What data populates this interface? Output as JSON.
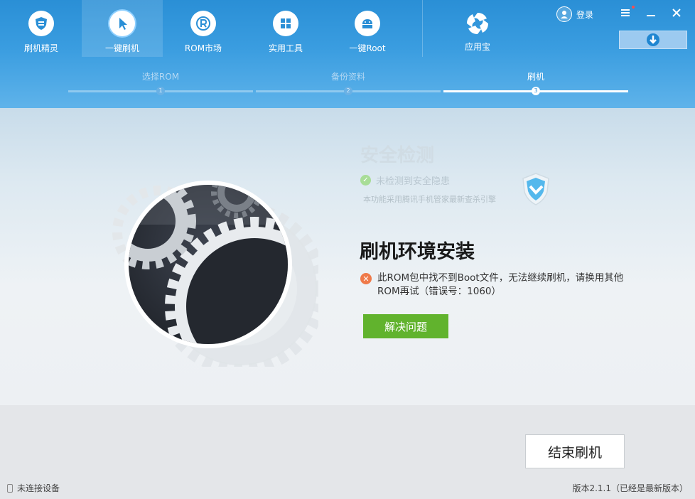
{
  "nav": {
    "items": [
      {
        "label": "刷机精灵",
        "icon": "shield-logo-icon"
      },
      {
        "label": "一键刷机",
        "icon": "cursor-icon"
      },
      {
        "label": "ROM市场",
        "icon": "rom-icon"
      },
      {
        "label": "实用工具",
        "icon": "grid-icon"
      },
      {
        "label": "一键Root",
        "icon": "android-icon"
      },
      {
        "label": "应用宝",
        "icon": "app-store-icon"
      }
    ],
    "active_index": 1
  },
  "header": {
    "login_label": "登录",
    "controls": [
      "menu-icon",
      "minimize-icon",
      "close-icon"
    ]
  },
  "steps": [
    {
      "label": "选择ROM",
      "num": "1"
    },
    {
      "label": "备份资料",
      "num": "2"
    },
    {
      "label": "刷机",
      "num": "3"
    }
  ],
  "current_step": 3,
  "security": {
    "title": "安全检测",
    "status": "未检测到安全隐患",
    "note": "本功能采用腾讯手机管家最新查杀引擎"
  },
  "main": {
    "title": "刷机环境安装",
    "error_text": "此ROM包中找不到Boot文件，无法继续刷机，请换用其他ROM再试（错误号：1060）",
    "fix_button": "解决问题"
  },
  "bottom": {
    "end_button": "结束刷机",
    "device_status": "未连接设备",
    "version": "版本2.1.1（已经是最新版本）"
  },
  "colors": {
    "header_blue": "#2a8fd6",
    "fix_green": "#61b32d",
    "error_orange": "#ef7a4a",
    "ok_green": "#a8dd97"
  }
}
